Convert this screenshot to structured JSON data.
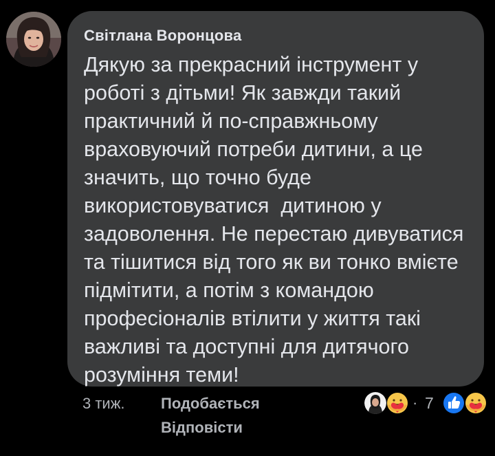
{
  "comment": {
    "author": "Світлана Воронцова",
    "text_lines": [
      "Дякую за прекрасний інструмент у",
      "роботі з дітьми! Як завжди такий",
      "практичний й по-справжньому",
      "враховуючий потреби дитини, а це",
      "значить, що точно буде",
      "використовуватися  дитиною у",
      "задоволення. Не перестаю дивуватися",
      "та тішитися від того як ви тонко вмієте",
      "підмітити, а потім з командою",
      "професіоналів втілити у життя такі",
      "важливі та доступні для дитячого",
      "розуміння теми!"
    ],
    "timestamp": "3 тиж.",
    "actions": {
      "like_label": "Подобається",
      "reply_label": "Відповісти"
    }
  },
  "reactions": {
    "separator": "·",
    "count": "7",
    "icons": [
      "profile-thumbnail-icon",
      "care-emoji-icon",
      "like-thumb-icon",
      "care-emoji-icon"
    ]
  },
  "colors": {
    "background": "#000000",
    "bubble": "#3a3b3c",
    "primary_text": "#e4e6eb",
    "secondary_text": "#b0b3b8",
    "like_blue": "#1877f2",
    "care_yellow": "#f7c64a",
    "care_heart": "#e8303f"
  }
}
